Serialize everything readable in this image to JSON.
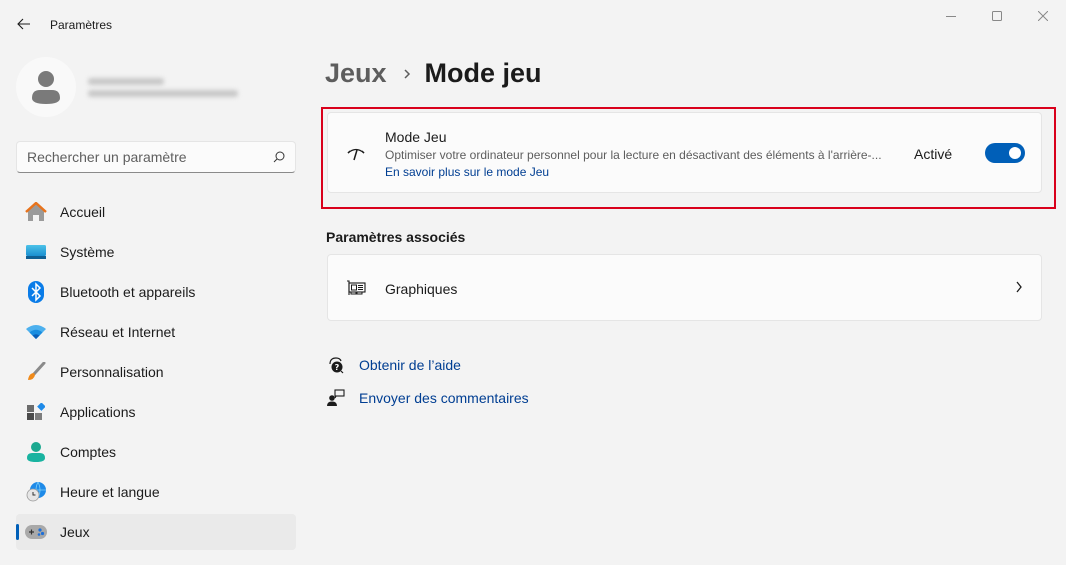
{
  "window": {
    "title": "Paramètres",
    "controls": [
      "minimize",
      "maximize",
      "close"
    ]
  },
  "profile": {
    "name": "[blurred]",
    "email": "[blurred]"
  },
  "search": {
    "placeholder": "Rechercher un paramètre",
    "value": ""
  },
  "sidebar": {
    "items": [
      {
        "label": "Accueil",
        "icon": "home-icon"
      },
      {
        "label": "Système",
        "icon": "system-icon"
      },
      {
        "label": "Bluetooth et appareils",
        "icon": "bluetooth-icon"
      },
      {
        "label": "Réseau et Internet",
        "icon": "wifi-icon"
      },
      {
        "label": "Personnalisation",
        "icon": "brush-icon"
      },
      {
        "label": "Applications",
        "icon": "apps-icon"
      },
      {
        "label": "Comptes",
        "icon": "account-icon"
      },
      {
        "label": "Heure et langue",
        "icon": "time-language-icon"
      },
      {
        "label": "Jeux",
        "icon": "gamepad-icon",
        "active": true
      }
    ],
    "accent_color": "#005fb8"
  },
  "breadcrumb": {
    "parent": "Jeux",
    "current": "Mode jeu"
  },
  "game_mode": {
    "title": "Mode Jeu",
    "description": "Optimiser votre ordinateur personnel pour la lecture en désactivant des éléments à l'arrière-...",
    "link": "En savoir plus sur le mode Jeu",
    "status": "Activé",
    "enabled": true,
    "highlight_color": "#d9001b"
  },
  "related": {
    "title": "Paramètres associés",
    "items": [
      {
        "label": "Graphiques",
        "icon": "graphics-card-icon"
      }
    ]
  },
  "help_links": [
    {
      "label": "Obtenir de l’aide",
      "icon": "help-icon"
    },
    {
      "label": "Envoyer des commentaires",
      "icon": "feedback-icon"
    }
  ]
}
